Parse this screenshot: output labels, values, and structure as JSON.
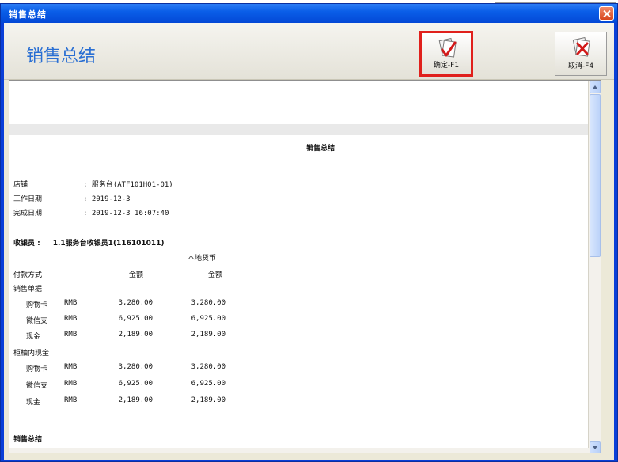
{
  "window": {
    "title": "销售总结"
  },
  "header": {
    "title": "销售总结"
  },
  "toolbar": {
    "confirm_label": "确定-F1",
    "cancel_label": "取消-F4"
  },
  "report": {
    "title": "销售总结",
    "info": [
      {
        "label": "店铺",
        "value": ": 服务台(ATF101H01-01)"
      },
      {
        "label": "工作日期",
        "value": ": 2019-12-3"
      },
      {
        "label": "完成日期",
        "value": ": 2019-12-3 16:07:40"
      }
    ],
    "cashier_label": "收银员 :",
    "cashier_value": "1.1服务台收银员1(116101011)",
    "col_local_currency": "本地货币",
    "col_payment_method": "付款方式",
    "col_amount_1": "金额",
    "col_amount_2": "金额",
    "sections": [
      {
        "title": "销售单据",
        "rows": [
          {
            "name": "购物卡",
            "currency": "RMB",
            "amount": "3,280.00",
            "local_amount": "3,280.00"
          },
          {
            "name": "微信支",
            "currency": "RMB",
            "amount": "6,925.00",
            "local_amount": "6,925.00"
          },
          {
            "name": "现金",
            "currency": "RMB",
            "amount": "2,189.00",
            "local_amount": "2,189.00"
          }
        ]
      },
      {
        "title": "柜柚内现金",
        "rows": [
          {
            "name": "购物卡",
            "currency": "RMB",
            "amount": "3,280.00",
            "local_amount": "3,280.00"
          },
          {
            "name": "微信支",
            "currency": "RMB",
            "amount": "6,925.00",
            "local_amount": "6,925.00"
          },
          {
            "name": "现金",
            "currency": "RMB",
            "amount": "2,189.00",
            "local_amount": "2,189.00"
          }
        ]
      }
    ],
    "summary_title": "销售总结"
  },
  "icons": {
    "confirm": "checkmark-document-icon",
    "cancel": "cross-document-icon",
    "close": "close-icon"
  },
  "colors": {
    "titlebar": "#0a5ee8",
    "header_title": "#2a6fd3",
    "highlight_border": "#e0201c"
  }
}
